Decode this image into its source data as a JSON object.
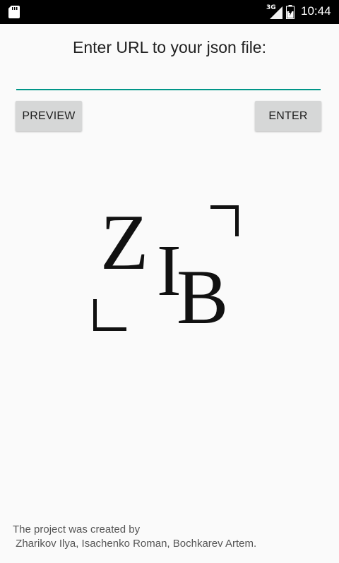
{
  "status_bar": {
    "network_type": "3G",
    "time": "10:44",
    "icons": [
      "sd-card-icon",
      "signal-icon",
      "battery-charging-icon"
    ]
  },
  "main": {
    "prompt_title": "Enter URL to your json file:",
    "url_input": {
      "value": "",
      "placeholder": ""
    },
    "preview_button_label": "PREVIEW",
    "enter_button_label": "ENTER"
  },
  "logo": {
    "letter_1": "Z",
    "letter_2": "I",
    "letter_3": "B"
  },
  "footer": {
    "credits_line_1": "The project was created by",
    "credits_line_2": " Zharikov Ilya, Isachenko Roman, Bochkarev Artem."
  },
  "colors": {
    "status_bar_bg": "#000000",
    "background": "#fafafa",
    "input_underline": "#009688",
    "button_bg": "#d6d7d7",
    "text_primary": "#212121",
    "text_secondary": "#555555"
  }
}
